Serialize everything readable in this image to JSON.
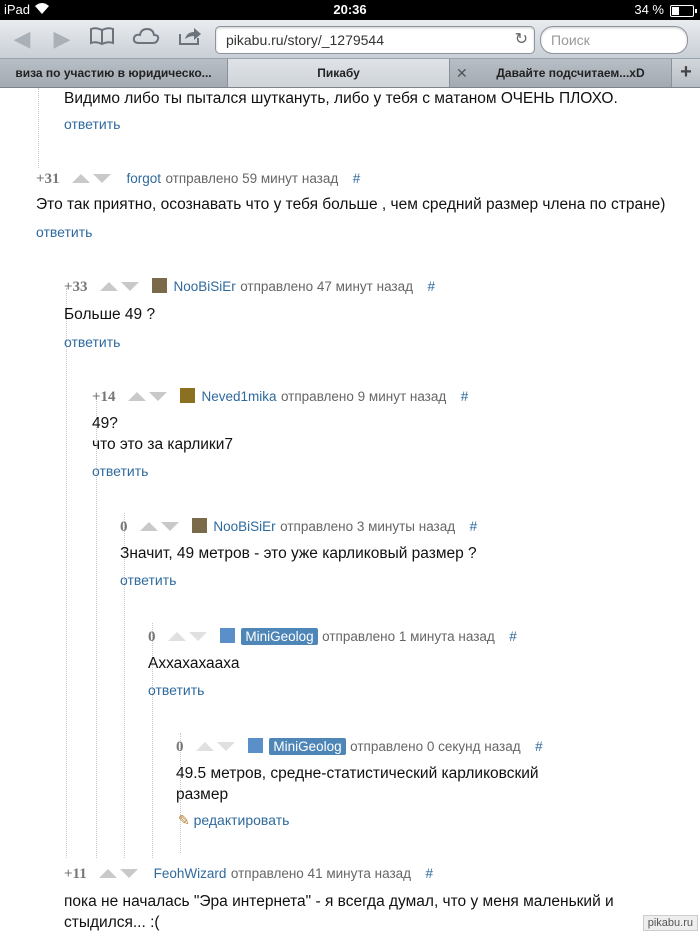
{
  "status": {
    "carrier": "iPad",
    "time": "20:36",
    "battery": "34 %",
    "battery_level": 0.34
  },
  "toolbar": {
    "url": "pikabu.ru/story/_1279544",
    "search_placeholder": "Поиск"
  },
  "tabs": [
    {
      "label": "виза по участию в юридическо..."
    },
    {
      "label": "Пикабу"
    },
    {
      "label": "Давайте подсчитаем...xD"
    }
  ],
  "comments": [
    {
      "text": "Видимо либо ты пытался шуткануть, либо у тебя с матаном ОЧЕНЬ ПЛОХО.",
      "reply": "ответить"
    },
    {
      "score": "+31",
      "user": "forgot",
      "meta": "отправлено 59 минут назад",
      "hash": "#",
      "lines": [
        "Это так приятно, осознавать что у тебя больше , чем средний размер члена по стране)"
      ],
      "reply": "ответить"
    },
    {
      "score": "+33",
      "user": "NooBiSiEr",
      "meta": "отправлено 47 минут назад",
      "hash": "#",
      "lines": [
        "Больше 49 ?"
      ],
      "reply": "ответить"
    },
    {
      "score": "+14",
      "user": "Neved1mika",
      "meta": "отправлено 9 минут назад",
      "hash": "#",
      "lines": [
        "49?",
        "что это за карлики7"
      ],
      "reply": "ответить"
    },
    {
      "score": "0",
      "user": "NooBiSiEr",
      "meta": "отправлено 3 минуты назад",
      "hash": "#",
      "lines": [
        "Значит, 49 метров - это уже карликовый размер ?"
      ],
      "reply": "ответить"
    },
    {
      "score": "0",
      "user": "MiniGeolog",
      "meta": "отправлено 1 минута назад",
      "hash": "#",
      "lines": [
        "Аххахахааха"
      ],
      "reply": "ответить"
    },
    {
      "score": "0",
      "user": "MiniGeolog",
      "meta": "отправлено 0 секунд назад",
      "hash": "#",
      "lines": [
        "49.5 метров, средне-статистический карликовский",
        "размер"
      ],
      "edit": "редактировать"
    },
    {
      "score": "+11",
      "user": "FeohWizard",
      "meta": "отправлено 41 минута назад",
      "hash": "#",
      "lines": [
        "пока не началась \"Эра интернета\" - я всегда думал, что у меня маленький и",
        "стыдился... :("
      ]
    }
  ],
  "watermark": "pikabu.ru"
}
